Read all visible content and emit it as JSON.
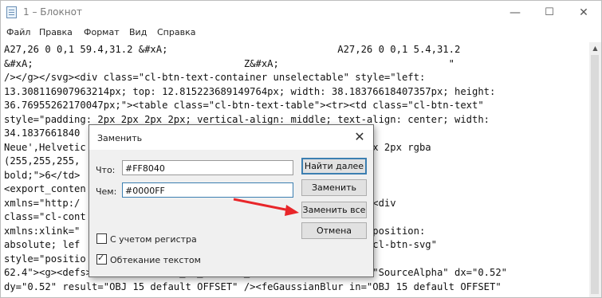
{
  "window": {
    "title": "1 – Блокнот",
    "icon": "notepad-icon"
  },
  "titlebar": {
    "minimize": "—",
    "maximize": "☐",
    "close": "✕"
  },
  "menu": [
    "Файл",
    "Правка",
    "Формат",
    "Вид",
    "Справка"
  ],
  "editor": {
    "lines": [
      "A27,26 0 0,1 59.4,31.2 &#xA;                             A27,26 0 0,1 5.4,31.2",
      "&#xA;                                    Z&#xA;                             \"",
      "/></g></svg><div class=\"cl-btn-text-container unselectable\" style=\"left:",
      "13.308116907963214px; top: 12.815223689149764px; width: 38.18376618407357px; height:",
      "36.76955262170047px;\"><table class=\"cl-btn-text-table\"><tr><td class=\"cl-btn-text\"",
      "style=\"padding: 2px 2px 2px 2px; vertical-align: middle; text-align: center; width:",
      "34.1837661840                            ily: Arial,'Helvetica",
      "Neue',Helvetic                           0; text-shadow: 1px 1px 2px rgba",
      "(255,255,255,",
      "bold;\">6</td>                            lign_content>",
      "<export_conten                            style=\"display: none\"",
      "xmlns=\"http:/                            .w3.org/1999/xlink\" /><div",
      "class=\"cl-cont",
      "xmlns:xlink=\"                            btn-container\" style=\"position:",
      "absolute; lef                             62.4px;\"><svg class=\"cl-btn-svg\"",
      "style=\"positio                            viewBox=\"0 0 64.8",
      "62.4\"><g><defs><filter id=\"OBJ_15_default_SHADOW\"><feOffset in=\"SourceAlpha\" dx=\"0.52\"",
      "dy=\"0.52\" result=\"OBJ 15 default OFFSET\" /><feGaussianBlur in=\"OBJ 15 default OFFSET\""
    ]
  },
  "dialog": {
    "title": "Заменить",
    "find_label": "Что:",
    "find_value": "#FF8040",
    "replace_label": "Чем:",
    "replace_value": "#0000FF",
    "find_next": "Найти далее",
    "replace": "Заменить",
    "replace_all": "Заменить все",
    "cancel": "Отмена",
    "match_case": "С учетом регистра",
    "wrap_around": "Обтекание текстом",
    "match_case_checked": false,
    "wrap_around_checked": true
  },
  "annotation": {
    "arrow_color": "#e8262a"
  }
}
